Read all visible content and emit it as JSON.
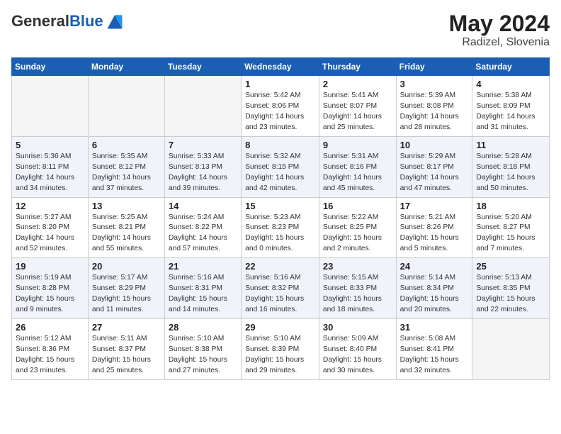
{
  "header": {
    "logo_general": "General",
    "logo_blue": "Blue",
    "month_year": "May 2024",
    "location": "Radizel, Slovenia"
  },
  "weekdays": [
    "Sunday",
    "Monday",
    "Tuesday",
    "Wednesday",
    "Thursday",
    "Friday",
    "Saturday"
  ],
  "weeks": [
    [
      {
        "day": "",
        "info": ""
      },
      {
        "day": "",
        "info": ""
      },
      {
        "day": "",
        "info": ""
      },
      {
        "day": "1",
        "info": "Sunrise: 5:42 AM\nSunset: 8:06 PM\nDaylight: 14 hours\nand 23 minutes."
      },
      {
        "day": "2",
        "info": "Sunrise: 5:41 AM\nSunset: 8:07 PM\nDaylight: 14 hours\nand 25 minutes."
      },
      {
        "day": "3",
        "info": "Sunrise: 5:39 AM\nSunset: 8:08 PM\nDaylight: 14 hours\nand 28 minutes."
      },
      {
        "day": "4",
        "info": "Sunrise: 5:38 AM\nSunset: 8:09 PM\nDaylight: 14 hours\nand 31 minutes."
      }
    ],
    [
      {
        "day": "5",
        "info": "Sunrise: 5:36 AM\nSunset: 8:11 PM\nDaylight: 14 hours\nand 34 minutes."
      },
      {
        "day": "6",
        "info": "Sunrise: 5:35 AM\nSunset: 8:12 PM\nDaylight: 14 hours\nand 37 minutes."
      },
      {
        "day": "7",
        "info": "Sunrise: 5:33 AM\nSunset: 8:13 PM\nDaylight: 14 hours\nand 39 minutes."
      },
      {
        "day": "8",
        "info": "Sunrise: 5:32 AM\nSunset: 8:15 PM\nDaylight: 14 hours\nand 42 minutes."
      },
      {
        "day": "9",
        "info": "Sunrise: 5:31 AM\nSunset: 8:16 PM\nDaylight: 14 hours\nand 45 minutes."
      },
      {
        "day": "10",
        "info": "Sunrise: 5:29 AM\nSunset: 8:17 PM\nDaylight: 14 hours\nand 47 minutes."
      },
      {
        "day": "11",
        "info": "Sunrise: 5:28 AM\nSunset: 8:18 PM\nDaylight: 14 hours\nand 50 minutes."
      }
    ],
    [
      {
        "day": "12",
        "info": "Sunrise: 5:27 AM\nSunset: 8:20 PM\nDaylight: 14 hours\nand 52 minutes."
      },
      {
        "day": "13",
        "info": "Sunrise: 5:25 AM\nSunset: 8:21 PM\nDaylight: 14 hours\nand 55 minutes."
      },
      {
        "day": "14",
        "info": "Sunrise: 5:24 AM\nSunset: 8:22 PM\nDaylight: 14 hours\nand 57 minutes."
      },
      {
        "day": "15",
        "info": "Sunrise: 5:23 AM\nSunset: 8:23 PM\nDaylight: 15 hours\nand 0 minutes."
      },
      {
        "day": "16",
        "info": "Sunrise: 5:22 AM\nSunset: 8:25 PM\nDaylight: 15 hours\nand 2 minutes."
      },
      {
        "day": "17",
        "info": "Sunrise: 5:21 AM\nSunset: 8:26 PM\nDaylight: 15 hours\nand 5 minutes."
      },
      {
        "day": "18",
        "info": "Sunrise: 5:20 AM\nSunset: 8:27 PM\nDaylight: 15 hours\nand 7 minutes."
      }
    ],
    [
      {
        "day": "19",
        "info": "Sunrise: 5:19 AM\nSunset: 8:28 PM\nDaylight: 15 hours\nand 9 minutes."
      },
      {
        "day": "20",
        "info": "Sunrise: 5:17 AM\nSunset: 8:29 PM\nDaylight: 15 hours\nand 11 minutes."
      },
      {
        "day": "21",
        "info": "Sunrise: 5:16 AM\nSunset: 8:31 PM\nDaylight: 15 hours\nand 14 minutes."
      },
      {
        "day": "22",
        "info": "Sunrise: 5:16 AM\nSunset: 8:32 PM\nDaylight: 15 hours\nand 16 minutes."
      },
      {
        "day": "23",
        "info": "Sunrise: 5:15 AM\nSunset: 8:33 PM\nDaylight: 15 hours\nand 18 minutes."
      },
      {
        "day": "24",
        "info": "Sunrise: 5:14 AM\nSunset: 8:34 PM\nDaylight: 15 hours\nand 20 minutes."
      },
      {
        "day": "25",
        "info": "Sunrise: 5:13 AM\nSunset: 8:35 PM\nDaylight: 15 hours\nand 22 minutes."
      }
    ],
    [
      {
        "day": "26",
        "info": "Sunrise: 5:12 AM\nSunset: 8:36 PM\nDaylight: 15 hours\nand 23 minutes."
      },
      {
        "day": "27",
        "info": "Sunrise: 5:11 AM\nSunset: 8:37 PM\nDaylight: 15 hours\nand 25 minutes."
      },
      {
        "day": "28",
        "info": "Sunrise: 5:10 AM\nSunset: 8:38 PM\nDaylight: 15 hours\nand 27 minutes."
      },
      {
        "day": "29",
        "info": "Sunrise: 5:10 AM\nSunset: 8:39 PM\nDaylight: 15 hours\nand 29 minutes."
      },
      {
        "day": "30",
        "info": "Sunrise: 5:09 AM\nSunset: 8:40 PM\nDaylight: 15 hours\nand 30 minutes."
      },
      {
        "day": "31",
        "info": "Sunrise: 5:08 AM\nSunset: 8:41 PM\nDaylight: 15 hours\nand 32 minutes."
      },
      {
        "day": "",
        "info": ""
      }
    ]
  ]
}
